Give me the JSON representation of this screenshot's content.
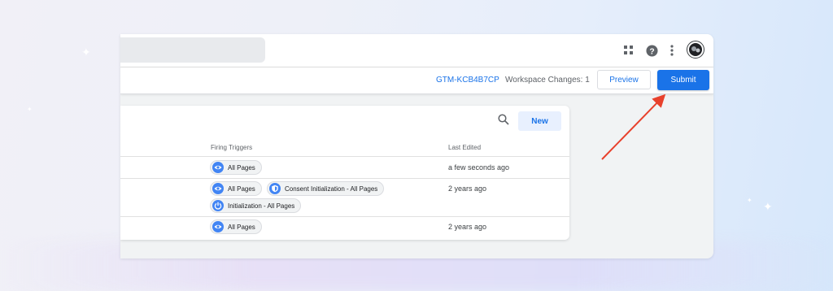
{
  "header": {
    "container_id": "GTM-KCB4B7CP",
    "workspace_changes": "Workspace Changes: 1",
    "preview_label": "Preview",
    "submit_label": "Submit",
    "icons": [
      "apps-grid-icon",
      "help-icon",
      "more-vert-icon",
      "avatar"
    ]
  },
  "table": {
    "new_button": "New",
    "columns": {
      "firing_triggers": "Firing Triggers",
      "last_edited": "Last Edited"
    },
    "rows": [
      {
        "triggers": [
          {
            "label": "All Pages",
            "icon": "eye-icon"
          }
        ],
        "last_edited": "a few seconds ago"
      },
      {
        "triggers": [
          {
            "label": "All Pages",
            "icon": "eye-icon"
          },
          {
            "label": "Consent Initialization - All Pages",
            "icon": "shield-icon"
          },
          {
            "label": "Initialization - All Pages",
            "icon": "power-icon"
          }
        ],
        "last_edited": "2 years ago"
      },
      {
        "triggers": [
          {
            "label": "All Pages",
            "icon": "eye-icon"
          }
        ],
        "last_edited": "2 years ago"
      }
    ]
  },
  "colors": {
    "accent": "#1a73e8",
    "annotation_arrow": "#e8412c",
    "chip_icon": "#4285f4"
  }
}
